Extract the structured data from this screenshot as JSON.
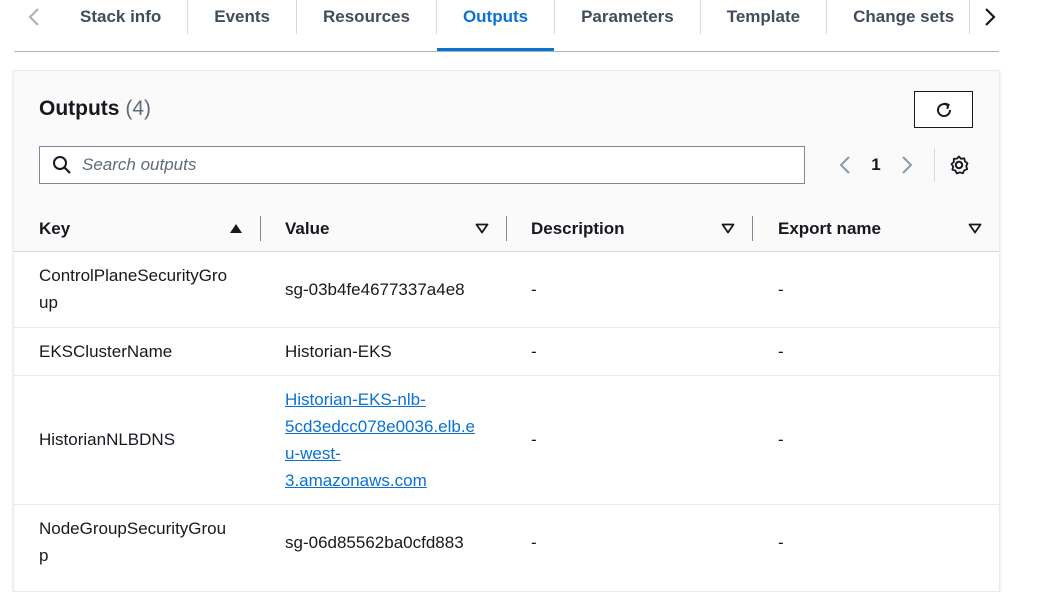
{
  "tabs": {
    "items": [
      {
        "label": "Stack info",
        "active": false
      },
      {
        "label": "Events",
        "active": false
      },
      {
        "label": "Resources",
        "active": false
      },
      {
        "label": "Outputs",
        "active": true
      },
      {
        "label": "Parameters",
        "active": false
      },
      {
        "label": "Template",
        "active": false
      },
      {
        "label": "Change sets",
        "active": false
      }
    ],
    "prev_icon": "chevron-left-icon",
    "next_icon": "chevron-right-icon"
  },
  "outputs": {
    "title": "Outputs",
    "count": "(4)",
    "refresh_icon": "refresh-icon",
    "search": {
      "placeholder": "Search outputs",
      "value": ""
    },
    "pagination": {
      "current_page": "1"
    },
    "settings_icon": "gear-icon"
  },
  "table": {
    "columns": [
      {
        "label": "Key",
        "sort": "ascending"
      },
      {
        "label": "Value",
        "sort": "none"
      },
      {
        "label": "Description",
        "sort": "none"
      },
      {
        "label": "Export name",
        "sort": "none"
      }
    ],
    "rows": [
      {
        "key": [
          "ControlPlaneSecurityGro",
          "up"
        ],
        "value": [
          "sg-03b4fe4677337a4e8"
        ],
        "value_is_link": false,
        "description": "-",
        "export_name": "-"
      },
      {
        "key": [
          "EKSClusterName"
        ],
        "value": [
          "Historian-EKS"
        ],
        "value_is_link": false,
        "description": "-",
        "export_name": "-"
      },
      {
        "key": [
          "HistorianNLBDNS"
        ],
        "value": [
          "Historian-EKS-nlb-",
          "5cd3edcc078e0036.elb.e",
          "u-west-",
          "3.amazonaws.com"
        ],
        "value_is_link": true,
        "description": "-",
        "export_name": "-"
      },
      {
        "key": [
          "NodeGroupSecurityGrou",
          "p"
        ],
        "value": [
          "sg-06d85562ba0cfd883"
        ],
        "value_is_link": false,
        "description": "-",
        "export_name": "-"
      }
    ]
  },
  "colors": {
    "accent": "#0972d3",
    "text": "#16191f",
    "muted": "#5f6b7a"
  }
}
